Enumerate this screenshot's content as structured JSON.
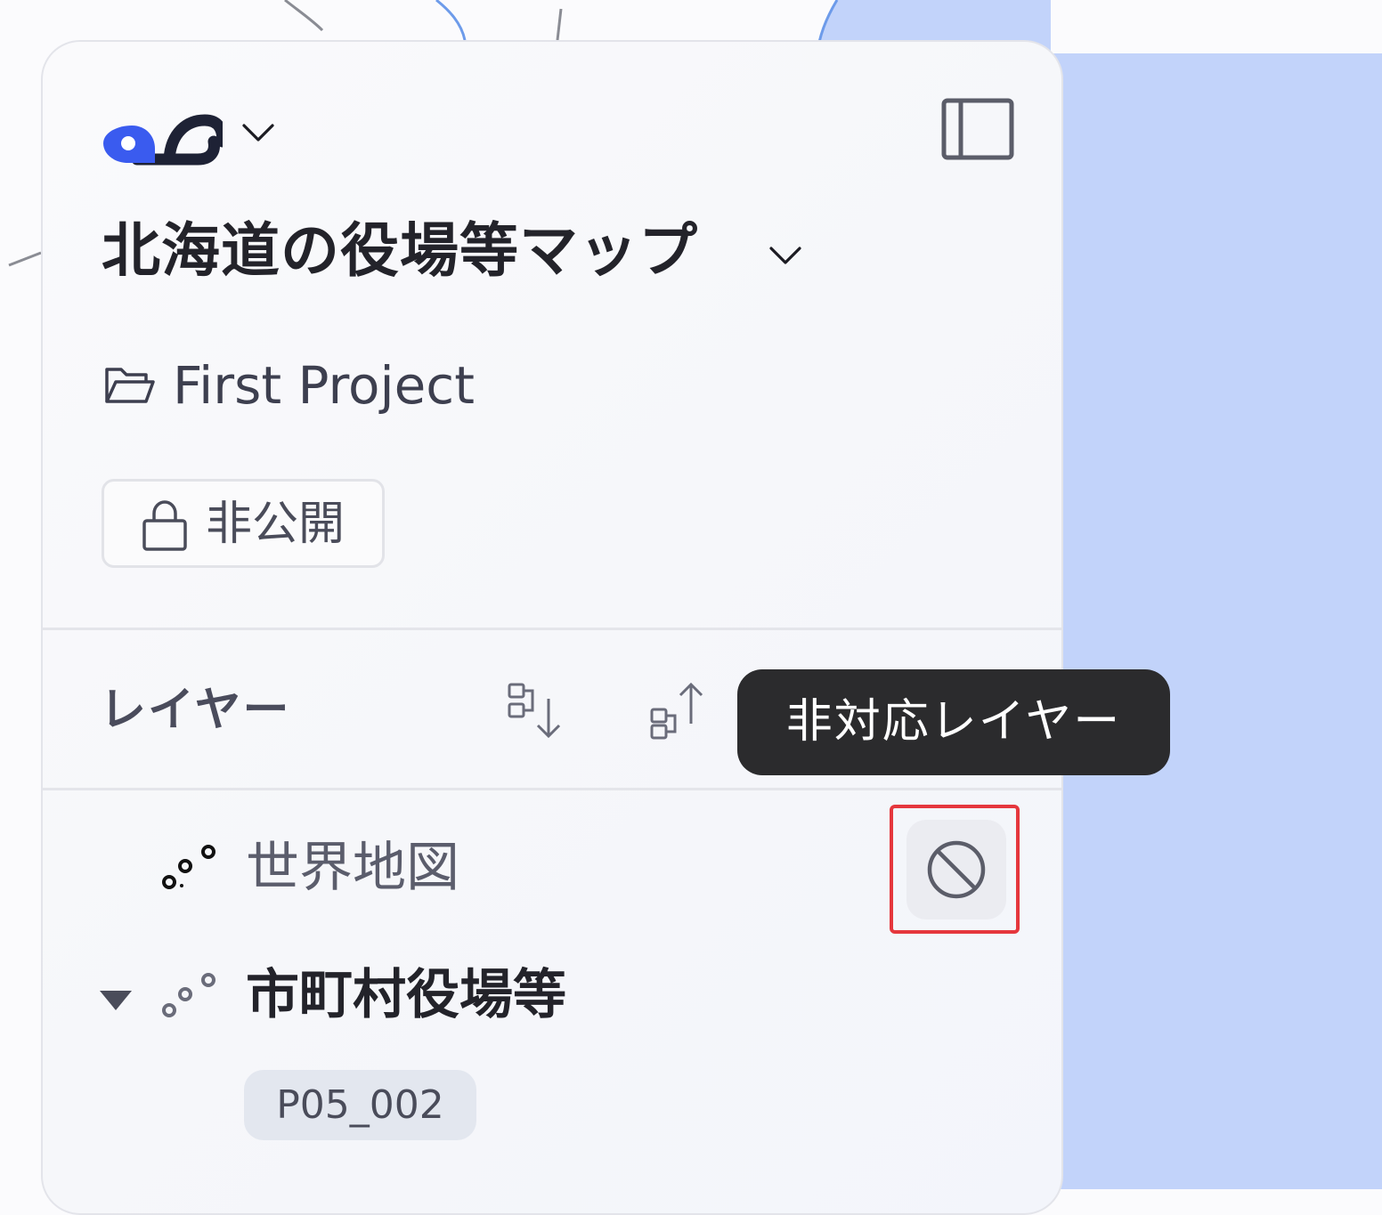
{
  "project": {
    "title": "北海道の役場等マップ",
    "folder_name": "First Project",
    "visibility_label": "非公開"
  },
  "layers": {
    "heading": "レイヤー",
    "items": [
      {
        "name": "世界地図",
        "action_icon": "prohibited-icon"
      },
      {
        "name": "市町村役場等",
        "expanded": true,
        "attribute_tag": "P05_002"
      }
    ]
  },
  "tooltip": {
    "text": "非対応レイヤー"
  },
  "colors": {
    "water": "#c2d3fa",
    "brand_blue": "#3a5bef",
    "tooltip_bg": "#2b2b2d",
    "highlight": "#e5373d"
  }
}
